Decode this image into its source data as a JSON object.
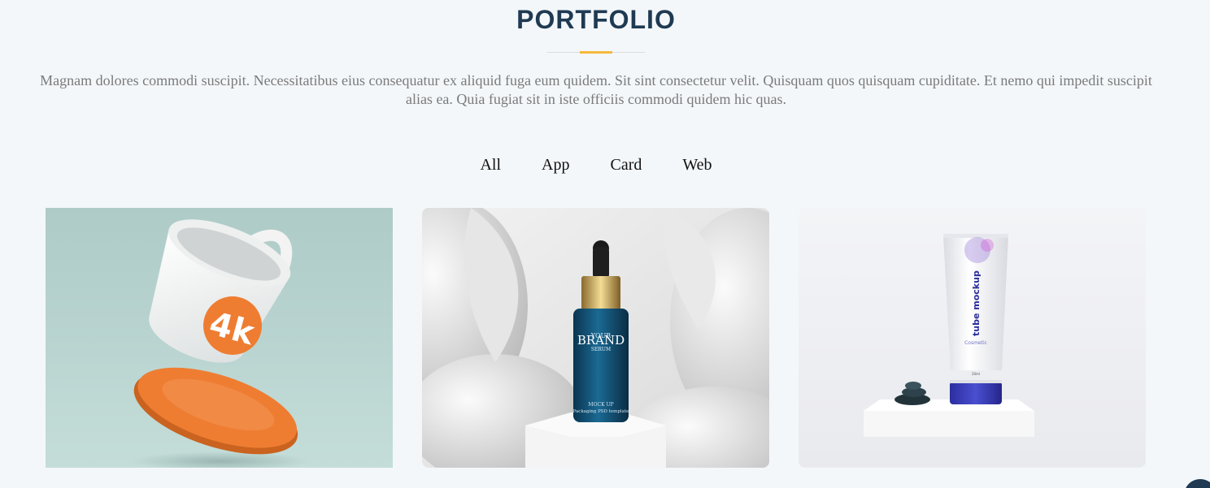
{
  "section": {
    "title": "PORTFOLIO",
    "description": "Magnam dolores commodi suscipit. Necessitatibus eius consequatur ex aliquid fuga eum quidem. Sit sint consectetur velit. Quisquam quos quisquam cupiditate. Et nemo qui impedit suscipit alias ea. Quia fugiat sit in iste officiis commodi quidem hic quas."
  },
  "filters": [
    {
      "label": "All",
      "active": true
    },
    {
      "label": "App",
      "active": false
    },
    {
      "label": "Card",
      "active": false
    },
    {
      "label": "Web",
      "active": false
    }
  ],
  "portfolio_items": [
    {
      "image": "mug-mockup",
      "logo_text": "4k"
    },
    {
      "image": "serum-bottle-mockup",
      "brand_line1": "YOUR",
      "brand_line2": "BRAND",
      "brand_line3": "SERUM",
      "mock_line1": "MOCK UP",
      "mock_line2": "Packaging PSD template"
    },
    {
      "image": "tube-mockup",
      "tube_label": "tube mockup",
      "tube_sub": "Cosmetic",
      "tube_size": "20ml"
    }
  ],
  "colors": {
    "title": "#1f3a52",
    "accent": "#f6b93b",
    "background": "#f4f7fa"
  }
}
